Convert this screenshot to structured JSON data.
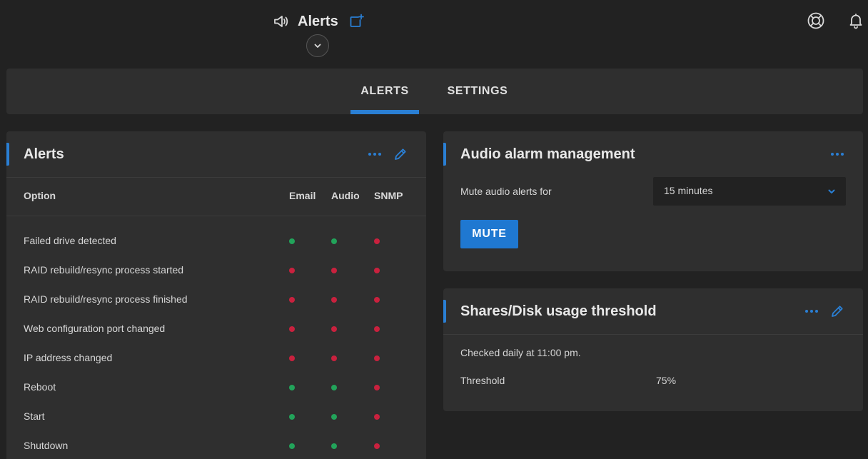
{
  "header": {
    "title": "Alerts",
    "icons": {
      "speaker": "speaker-icon",
      "new_window": "new-window-icon",
      "expand": "chevron-down-icon",
      "help": "lifebuoy-icon",
      "notifications": "bell-icon"
    }
  },
  "tabs": [
    {
      "label": "ALERTS",
      "active": true
    },
    {
      "label": "SETTINGS",
      "active": false
    }
  ],
  "alerts_card": {
    "title": "Alerts",
    "columns": {
      "option": "Option",
      "email": "Email",
      "audio": "Audio",
      "snmp": "SNMP"
    },
    "rows": [
      {
        "label": "Failed drive detected",
        "email": true,
        "audio": true,
        "snmp": false
      },
      {
        "label": "RAID rebuild/resync process started",
        "email": false,
        "audio": false,
        "snmp": false
      },
      {
        "label": "RAID rebuild/resync process finished",
        "email": false,
        "audio": false,
        "snmp": false
      },
      {
        "label": "Web configuration port changed",
        "email": false,
        "audio": false,
        "snmp": false
      },
      {
        "label": "IP address changed",
        "email": false,
        "audio": false,
        "snmp": false
      },
      {
        "label": "Reboot",
        "email": true,
        "audio": true,
        "snmp": false
      },
      {
        "label": "Start",
        "email": true,
        "audio": true,
        "snmp": false
      },
      {
        "label": "Shutdown",
        "email": true,
        "audio": true,
        "snmp": false
      }
    ]
  },
  "audio_card": {
    "title": "Audio alarm management",
    "mute_label": "Mute audio alerts for",
    "mute_duration": "15 minutes",
    "mute_button": "MUTE"
  },
  "share_card": {
    "title": "Shares/Disk usage threshold",
    "schedule": "Checked daily at 11:00 pm.",
    "threshold_label": "Threshold",
    "threshold_value": "75%"
  },
  "colors": {
    "accent": "#2a7fd4",
    "enabled": "#22a35a",
    "disabled": "#c9213e",
    "card": "#2f2f2f",
    "background": "#222222"
  }
}
